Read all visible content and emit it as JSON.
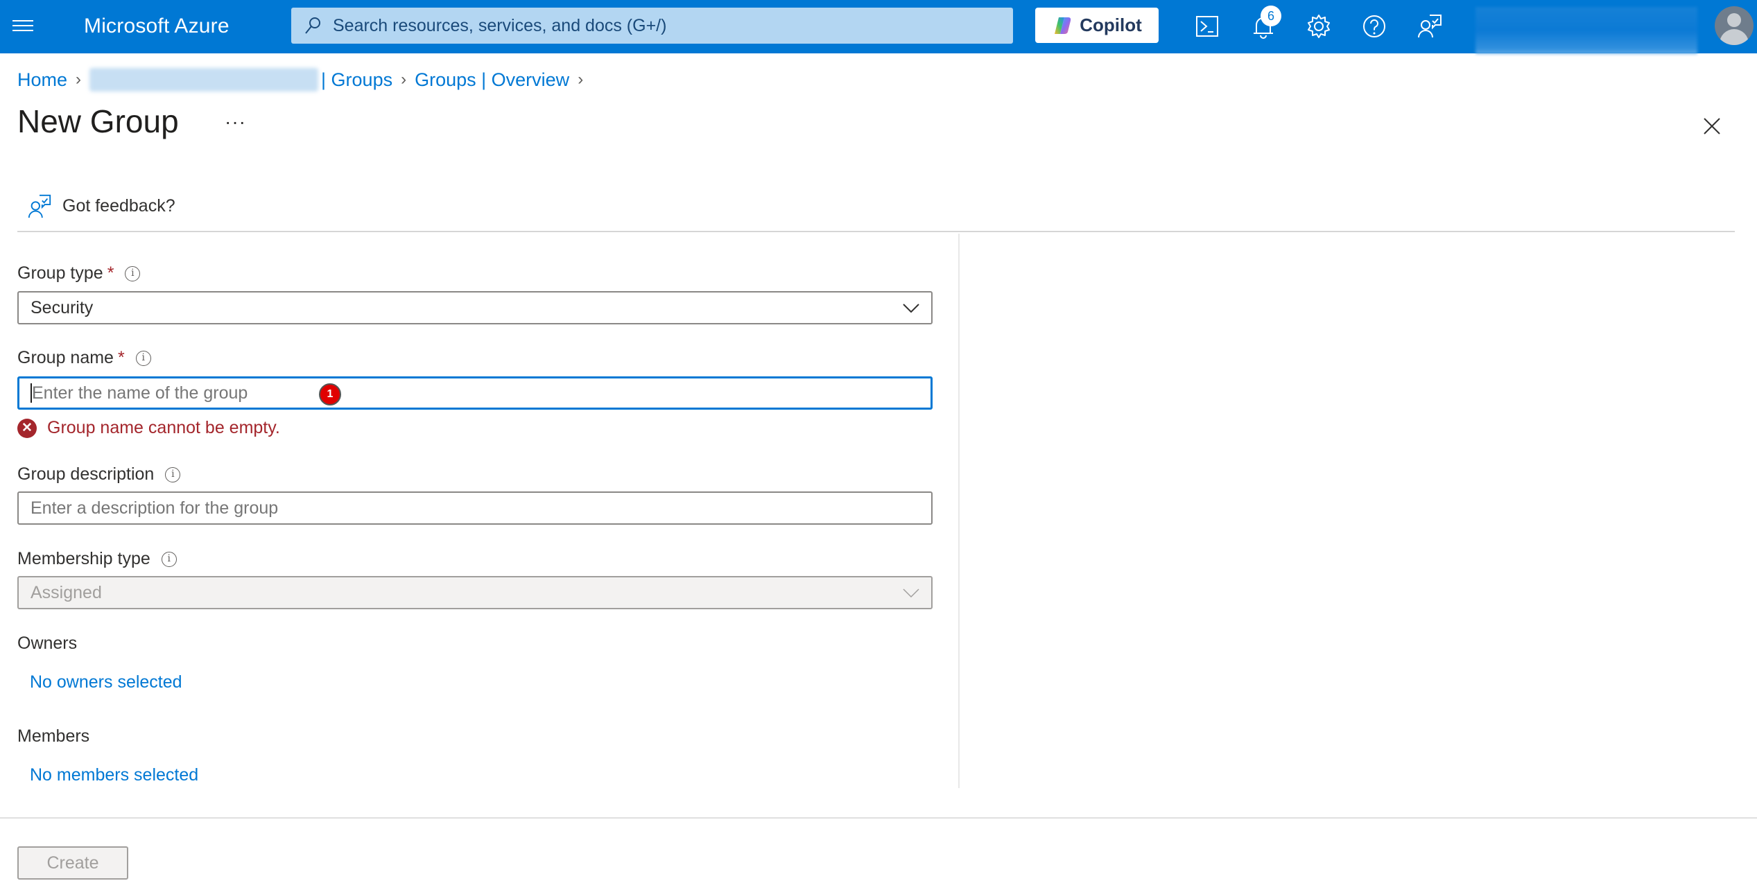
{
  "topbar": {
    "app_title": "Microsoft Azure",
    "search_placeholder": "Search resources, services, and docs (G+/)",
    "copilot_label": "Copilot",
    "notification_count": "6",
    "brand_color": "#0078d4"
  },
  "breadcrumb": {
    "items": [
      {
        "label": "Home"
      },
      {
        "label": "| Groups",
        "prefix_redacted": true
      },
      {
        "label": "Groups | Overview"
      }
    ]
  },
  "page": {
    "title": "New Group",
    "more_label": "···",
    "feedback_label": "Got feedback?"
  },
  "form": {
    "group_type": {
      "label": "Group type",
      "required_mark": "*",
      "info_glyph": "i",
      "value": "Security"
    },
    "group_name": {
      "label": "Group name",
      "required_mark": "*",
      "info_glyph": "i",
      "value": "",
      "placeholder": "Enter the name of the group",
      "marker": "1",
      "error_glyph": "✕",
      "error": "Group name cannot be empty."
    },
    "group_description": {
      "label": "Group description",
      "info_glyph": "i",
      "value": "",
      "placeholder": "Enter a description for the group"
    },
    "membership_type": {
      "label": "Membership type",
      "info_glyph": "i",
      "value": "Assigned",
      "disabled": true
    },
    "owners": {
      "label": "Owners",
      "link": "No owners selected"
    },
    "members": {
      "label": "Members",
      "link": "No members selected"
    }
  },
  "footer": {
    "create_label": "Create",
    "create_disabled": true
  },
  "colors": {
    "accent": "#0078d4",
    "error": "#a4262c",
    "marker": "#e00000"
  }
}
